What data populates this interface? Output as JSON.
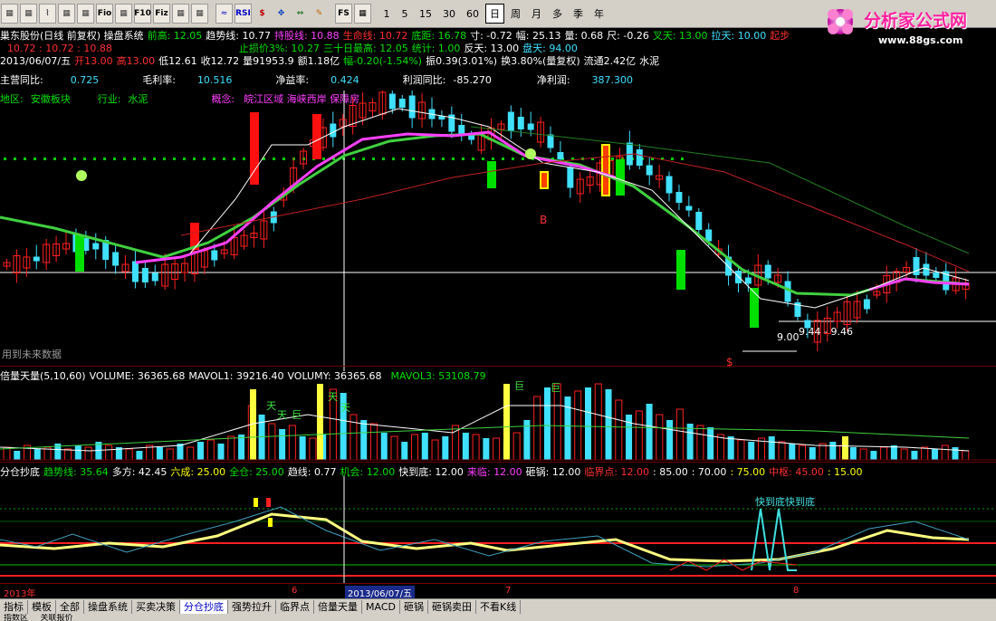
{
  "toolbar": {
    "icon_buttons": [
      "grid-icon",
      "grid-icon",
      "line-chart-icon",
      "table-icon",
      "table-icon",
      "fio-icon",
      "table-icon",
      "f10-icon",
      "fiz-icon",
      "table-icon",
      "table-icon",
      "wave-icon",
      "rsi-icon",
      "s-icon",
      "move-icon",
      "zoom-icon",
      "pen-icon",
      "fs-icon",
      "chart-icon"
    ],
    "labels": {
      "fio": "Fio",
      "f10": "F10",
      "fiz": "Fiz",
      "rsi": "RSI",
      "fs": "FS"
    },
    "periods": [
      "1",
      "5",
      "15",
      "30",
      "60",
      "日",
      "周",
      "月",
      "多",
      "季",
      "年"
    ],
    "selected_period": "日"
  },
  "logo": {
    "name": "分析家公式网",
    "url": "www.88gs.com"
  },
  "header": {
    "line1": [
      {
        "t": "巢东股份(日线 前复权) 操盘系统",
        "c": "w"
      },
      {
        "t": "前高: 12.05",
        "c": "g"
      },
      {
        "t": "趋势线: 10.77",
        "c": "w"
      },
      {
        "t": "持股线: 10.88",
        "c": "m"
      },
      {
        "t": "生命线: 10.72",
        "c": "r"
      },
      {
        "t": "底距: 16.78",
        "c": "g"
      },
      {
        "t": "寸: -0.72",
        "c": "w"
      },
      {
        "t": "幅: 25.13",
        "c": "w"
      },
      {
        "t": "量: 0.68",
        "c": "w"
      },
      {
        "t": "尺: -0.26",
        "c": "w"
      },
      {
        "t": "叉天: 13.00",
        "c": "g"
      },
      {
        "t": "拉天: 10.00",
        "c": "c"
      },
      {
        "t": "起步",
        "c": "r"
      }
    ],
    "line2": [
      {
        "t": "10.72 : 10.72 : 10.88",
        "c": "r"
      },
      {
        "t": "止损价3%: 10.27",
        "c": "g"
      },
      {
        "t": "三十日最高: 12.05",
        "c": "g"
      },
      {
        "t": "统计: 1.00",
        "c": "g"
      },
      {
        "t": "反天: 13.00",
        "c": "w"
      },
      {
        "t": "盘天: 94.00",
        "c": "c"
      }
    ],
    "line3": [
      {
        "t": "2013/06/07/五",
        "c": "w"
      },
      {
        "t": "开13.00",
        "c": "r"
      },
      {
        "t": "高13.00",
        "c": "r"
      },
      {
        "t": "低12.61",
        "c": "w"
      },
      {
        "t": "收12.72",
        "c": "w"
      },
      {
        "t": "量91953.9",
        "c": "w"
      },
      {
        "t": "额1.18亿",
        "c": "w"
      },
      {
        "t": "幅-0.20(-1.54%)",
        "c": "g"
      },
      {
        "t": "振0.39(3.01%)",
        "c": "w"
      },
      {
        "t": "换3.80%(量复权)",
        "c": "w"
      },
      {
        "t": "流通2.42亿",
        "c": "w"
      },
      {
        "t": "水泥",
        "c": "w"
      }
    ],
    "line4": [
      {
        "t": "主营同比:",
        "c": "w"
      },
      {
        "t": "0.725",
        "c": "c"
      },
      {
        "t": "毛利率:",
        "c": "w"
      },
      {
        "t": "10.516",
        "c": "c"
      },
      {
        "t": "净益率:",
        "c": "w"
      },
      {
        "t": "0.424",
        "c": "c"
      },
      {
        "t": "利润同比:",
        "c": "w"
      },
      {
        "t": "-85.270",
        "c": "w"
      },
      {
        "t": "净利润:",
        "c": "w"
      },
      {
        "t": "387.300",
        "c": "c"
      }
    ],
    "line5": [
      {
        "t": "地区:",
        "c": "g"
      },
      {
        "t": "安徽板块",
        "c": "g"
      },
      {
        "t": "行业:",
        "c": "g"
      },
      {
        "t": "水泥",
        "c": "g"
      },
      {
        "t": "概念:",
        "c": "m"
      },
      {
        "t": "皖江区域 海峡西岸 保障房",
        "c": "m"
      }
    ]
  },
  "main_chart": {
    "annotations": {
      "buy_mark": "B",
      "sell_mark": "$",
      "low_label": "9.00",
      "range_label": "9.44 - 9.46",
      "future_note": "用到未来数据"
    }
  },
  "volume_panel": {
    "header": [
      {
        "t": "倍量天量(5,10,60)",
        "c": "w"
      },
      {
        "t": "VOLUME: 36365.68",
        "c": "w"
      },
      {
        "t": "MAVOL1: 39216.40",
        "c": "w"
      },
      {
        "t": "VOLUMY: 36365.68",
        "c": "w"
      },
      {
        "t": "MAVOL3: 53108.79",
        "c": "g"
      }
    ],
    "marks": [
      "天",
      "天",
      "巨",
      "天",
      "天",
      "巨",
      "巨"
    ]
  },
  "indicator_panel": {
    "header": [
      {
        "t": "分仓抄底",
        "c": "w"
      },
      {
        "t": "趋势线: 35.64",
        "c": "g"
      },
      {
        "t": "多方: 42.45",
        "c": "w"
      },
      {
        "t": "六成: 25.00",
        "c": "y"
      },
      {
        "t": "全仓: 25.00",
        "c": "g"
      },
      {
        "t": "趋线: 0.77",
        "c": "w"
      },
      {
        "t": "机会: 12.00",
        "c": "g"
      },
      {
        "t": "快到底: 12.00",
        "c": "w"
      },
      {
        "t": "来临: 12.00",
        "c": "m"
      },
      {
        "t": "砸锅: 12.00",
        "c": "w"
      },
      {
        "t": "临界点: 12.00",
        "c": "r"
      },
      {
        "t": ": 85.00",
        "c": "w"
      },
      {
        "t": ": 70.00",
        "c": "w"
      },
      {
        "t": ": 75.00",
        "c": "y"
      },
      {
        "t": "中枢: 45.00",
        "c": "r"
      },
      {
        "t": ": 15.00",
        "c": "y"
      }
    ],
    "annotation": "快到底快到底"
  },
  "date_axis": {
    "labels": [
      "2013年",
      "6",
      "2013/06/07/五",
      "7",
      "8"
    ]
  },
  "bottom_tabs": {
    "items": [
      "指标",
      "模板",
      "全部",
      "操盘系统",
      "买卖决策",
      "分仓抄底",
      "强势拉升",
      "临界点",
      "倍量天量",
      "MACD",
      "砸锅",
      "砸锅卖田",
      "不看K线"
    ],
    "selected": "分仓抄底"
  },
  "status": {
    "items": [
      "指数区",
      "关联报价"
    ]
  },
  "colors": {
    "bg": "#000000",
    "up": "#ff2020",
    "down": "#40e0ff",
    "ma_magenta": "#ff40ff",
    "ma_green": "#40d040",
    "grid": "#6a0000"
  }
}
